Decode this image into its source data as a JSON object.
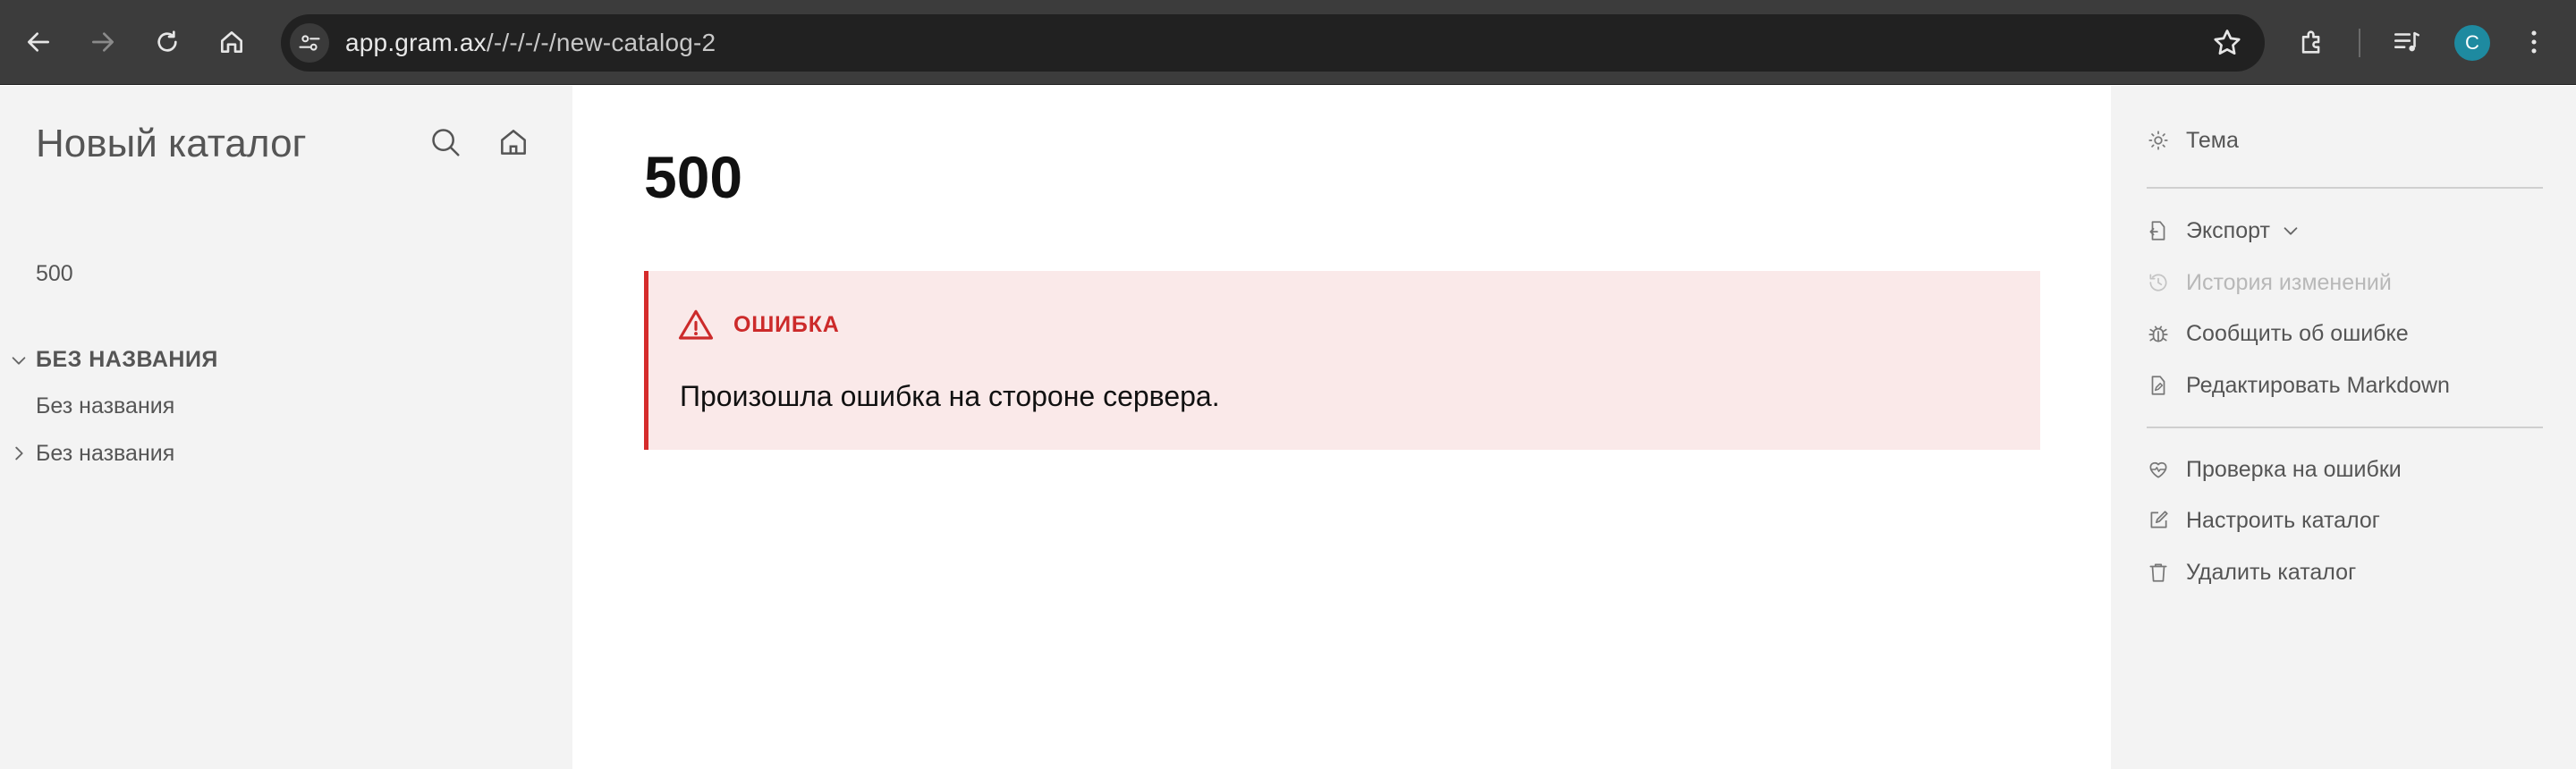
{
  "browser": {
    "url_host": "app.gram.ax",
    "url_path": "/-/-/-/-/new-catalog-2",
    "avatar_initial": "C"
  },
  "sidebar_left": {
    "catalog_title": "Новый каталог",
    "items": [
      {
        "label": "500"
      },
      {
        "label": "БЕЗ НАЗВАНИЯ",
        "expanded": true
      },
      {
        "label": "Без названия"
      },
      {
        "label": "Без названия",
        "expanded": false
      }
    ]
  },
  "main": {
    "title": "500",
    "alert": {
      "title": "ОШИБКА",
      "message": "Произошла ошибка на стороне сервера."
    }
  },
  "sidebar_right": {
    "theme": "Тема",
    "export": "Экспорт",
    "history": "История изменений",
    "report": "Сообщить об ошибке",
    "edit_markdown": "Редактировать Markdown",
    "check_errors": "Проверка на ошибки",
    "configure": "Настроить каталог",
    "delete": "Удалить каталог"
  },
  "colors": {
    "chrome_bg": "#3c3c3c",
    "omnibox_bg": "#212121",
    "sidebar_bg": "#f3f3f3",
    "alert_bg": "#fae9e9",
    "alert_accent": "#d52b2b",
    "avatar": "#1e8aa0"
  }
}
